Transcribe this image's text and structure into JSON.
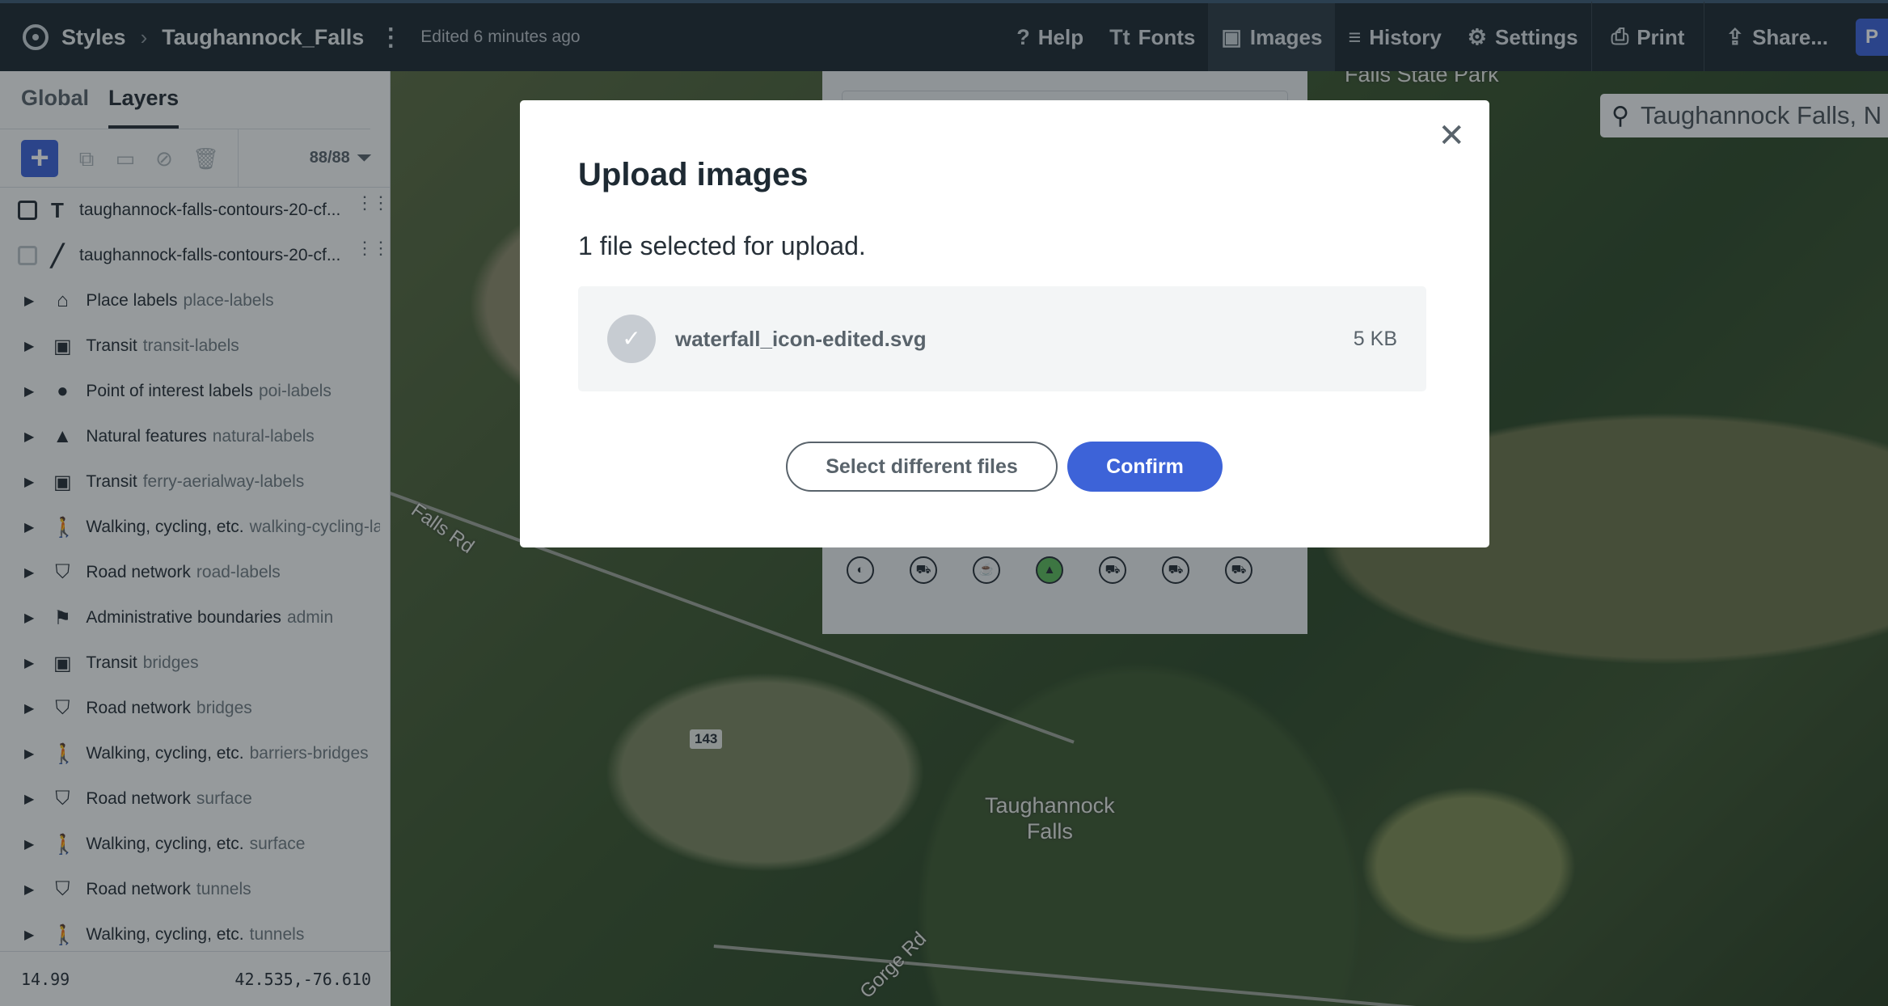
{
  "topbar": {
    "breadcrumb_root": "Styles",
    "style_name": "Taughannock_Falls",
    "edited": "Edited 6 minutes ago",
    "nav": [
      {
        "label": "Help",
        "icon": "help-icon",
        "glyph": "?"
      },
      {
        "label": "Fonts",
        "icon": "fonts-icon",
        "glyph": "Tt"
      },
      {
        "label": "Images",
        "icon": "images-icon",
        "glyph": "▣"
      },
      {
        "label": "History",
        "icon": "history-icon",
        "glyph": "≡"
      },
      {
        "label": "Settings",
        "icon": "settings-icon",
        "glyph": "⚙"
      }
    ],
    "print_label": "Print",
    "share_label": "Share...",
    "publish_initial": "P"
  },
  "sidebar": {
    "tabs": [
      "Global",
      "Layers"
    ],
    "active_tab": "Layers",
    "layer_count": "88/88",
    "layers": [
      {
        "name": "taughannock-falls-contours-20-cf...",
        "type_icon": "text-icon",
        "glyph": "T",
        "checked": true
      },
      {
        "name": "taughannock-falls-contours-20-cf...",
        "type_icon": "line-icon",
        "glyph": "╱",
        "checked": false
      }
    ],
    "groups": [
      {
        "name": "Place labels",
        "sub": "place-labels",
        "icon": "place-icon",
        "glyph": "⌂"
      },
      {
        "name": "Transit",
        "sub": "transit-labels",
        "icon": "transit-icon",
        "glyph": "▣"
      },
      {
        "name": "Point of interest labels",
        "sub": "poi-labels",
        "icon": "poi-icon",
        "glyph": "●"
      },
      {
        "name": "Natural features",
        "sub": "natural-labels",
        "icon": "natural-icon",
        "glyph": "▲"
      },
      {
        "name": "Transit",
        "sub": "ferry-aerialway-labels",
        "icon": "transit-icon",
        "glyph": "▣"
      },
      {
        "name": "Walking, cycling, etc.",
        "sub": "walking-cycling-lal",
        "icon": "walking-icon",
        "glyph": "🚶"
      },
      {
        "name": "Road network",
        "sub": "road-labels",
        "icon": "road-icon",
        "glyph": "⛉"
      },
      {
        "name": "Administrative boundaries",
        "sub": "admin",
        "icon": "admin-icon",
        "glyph": "⚑"
      },
      {
        "name": "Transit",
        "sub": "bridges",
        "icon": "transit-icon",
        "glyph": "▣"
      },
      {
        "name": "Road network",
        "sub": "bridges",
        "icon": "road-icon",
        "glyph": "⛉"
      },
      {
        "name": "Walking, cycling, etc.",
        "sub": "barriers-bridges",
        "icon": "walking-icon",
        "glyph": "🚶"
      },
      {
        "name": "Road network",
        "sub": "surface",
        "icon": "road-icon",
        "glyph": "⛉"
      },
      {
        "name": "Walking, cycling, etc.",
        "sub": "surface",
        "icon": "walking-icon",
        "glyph": "🚶"
      },
      {
        "name": "Road network",
        "sub": "tunnels",
        "icon": "road-icon",
        "glyph": "⛉"
      },
      {
        "name": "Walking, cycling, etc.",
        "sub": "tunnels",
        "icon": "walking-icon",
        "glyph": "🚶"
      }
    ],
    "zoom": "14.99",
    "coords": "42.535,-76.610"
  },
  "map": {
    "search_value": "Taughannock Falls, N",
    "labels": {
      "park": "Falls State Park",
      "falls_rd": "Falls Rd",
      "town": "Taughannock\nFalls",
      "gorge_rd": "Gorge Rd",
      "route": "143"
    }
  },
  "modal": {
    "title": "Upload images",
    "subtitle": "1 file selected for upload.",
    "file_name": "waterfall_icon-edited.svg",
    "file_size": "5 KB",
    "select_label": "Select different files",
    "confirm_label": "Confirm"
  },
  "colors": {
    "topbar_bg": "#1e2a33",
    "accent": "#3d63d8",
    "sidebar_bg": "#f5f6f7"
  }
}
